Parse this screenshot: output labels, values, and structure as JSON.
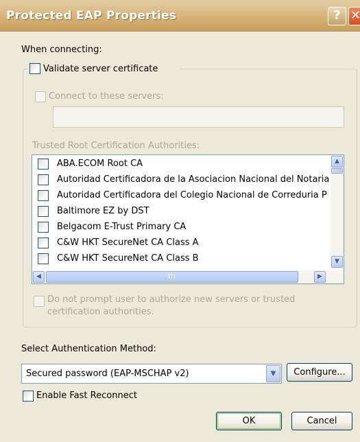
{
  "window": {
    "title": "Protected EAP Properties",
    "help_glyph": "?",
    "close_glyph": "✕"
  },
  "when_connecting_label": "When connecting:",
  "validate_cert": {
    "label": "Validate server certificate",
    "checked": false
  },
  "connect_servers": {
    "label": "Connect to these servers:",
    "checked": false,
    "enabled": false,
    "value": ""
  },
  "trusted_root": {
    "label": "Trusted Root Certification Authorities:",
    "items": [
      {
        "label": "ABA.ECOM Root CA",
        "checked": false
      },
      {
        "label": "Autoridad Certificadora de la Asociacion Nacional del Notaria",
        "checked": false
      },
      {
        "label": "Autoridad Certificadora del Colegio Nacional de Correduria P",
        "checked": false
      },
      {
        "label": "Baltimore EZ by DST",
        "checked": false
      },
      {
        "label": "Belgacom E-Trust Primary CA",
        "checked": false
      },
      {
        "label": "C&W HKT SecureNet CA Class A",
        "checked": false
      },
      {
        "label": "C&W HKT SecureNet CA Class B",
        "checked": false
      }
    ],
    "scroll_up_glyph": "▲",
    "scroll_down_glyph": "▼",
    "scroll_left_glyph": "◀",
    "scroll_right_glyph": "▶",
    "hthumb_grip": "III"
  },
  "no_prompt": {
    "line1": "Do not prompt user to authorize new servers or trusted",
    "line2": "certification authorities.",
    "checked": false,
    "enabled": false
  },
  "auth_method": {
    "label": "Select Authentication Method:",
    "selected": "Secured password (EAP-MSCHAP v2)",
    "arrow_glyph": "▼",
    "configure_label": "Configure..."
  },
  "fast_reconnect": {
    "label": "Enable Fast Reconnect",
    "checked": false
  },
  "buttons": {
    "ok": "OK",
    "cancel": "Cancel"
  },
  "colors": {
    "titlebar": "#d9b87f",
    "face": "#ece9d8",
    "border_blue": "#7f9db9",
    "disabled_text": "#a9a79b"
  }
}
